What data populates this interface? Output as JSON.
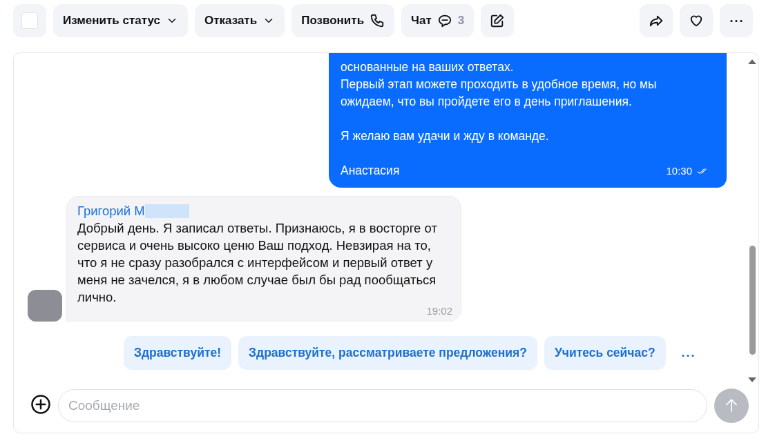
{
  "toolbar": {
    "select": {
      "checked": false
    },
    "buttons": [
      {
        "kind": "dropdown",
        "label": "Изменить статус"
      },
      {
        "kind": "dropdown",
        "label": "Отказать"
      },
      {
        "kind": "call",
        "label": "Позвонить"
      },
      {
        "kind": "chat",
        "label": "Чат",
        "count": "3"
      },
      {
        "kind": "edit"
      }
    ],
    "actions": [
      {
        "kind": "share"
      },
      {
        "kind": "favorite"
      },
      {
        "kind": "more"
      }
    ]
  },
  "messages": [
    {
      "kind": "outgoing",
      "paragraphs": [
        "основанные на ваших ответах.\nПервый этап можете проходить в удобное время, но мы ожидаем, что вы пройдете его в день приглашения.",
        "Я желаю вам удачи и жду в команде."
      ],
      "author": "Анастасия",
      "time": "10:30",
      "read": true
    },
    {
      "kind": "incoming",
      "author": "Григорий М",
      "author_redacted": true,
      "paragraphs": [
        "Добрый день. Я записал ответы. Признаюсь, я в восторге от сервиса и очень высоко ценю Ваш подход. Невзирая на то, что я не сразу разобрался с интерфейсом и первый ответ у меня не зачелся, я в любом случае был бы рад пообщаться лично."
      ],
      "time": "19:02"
    }
  ],
  "quick_replies": [
    "Здравствуйте!",
    "Здравствуйте, рассматриваете предложения?",
    "Учитесь сейчас?"
  ],
  "composer": {
    "placeholder": "Сообщение",
    "send_disabled": true
  }
}
